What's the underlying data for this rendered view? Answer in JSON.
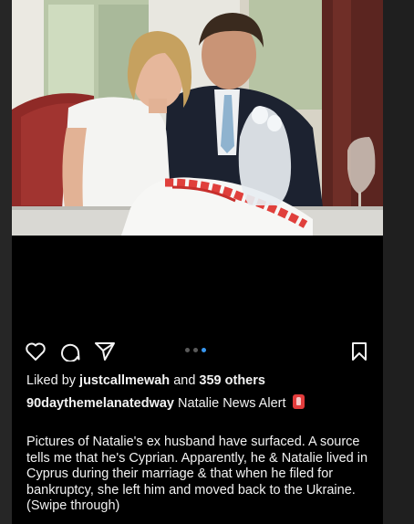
{
  "post": {
    "liked_by_prefix": "Liked by ",
    "liked_by_user": "justcallmewah",
    "liked_by_middle": " and ",
    "liked_by_count": "359 others",
    "username": "90daythemelanatedway",
    "caption_title": "Natalie News Alert",
    "caption_body": "Pictures of Natalie's ex husband have surfaced. A source tells me that he's Cyprian. Apparently, he & Natalie lived in Cyprus during their marriage & that when he filed for bankruptcy, she left him and moved back to the Ukraine. (Swipe through)",
    "carousel": {
      "total": 3,
      "active_index": 3
    }
  },
  "icons": {
    "like": "heart-icon",
    "comment": "comment-icon",
    "share": "paper-plane-icon",
    "save": "bookmark-icon",
    "alert": "alert-light-icon"
  },
  "colors": {
    "background": "#000000",
    "text": "#f2f2f2",
    "carousel_active": "#3897f0",
    "carousel_inactive": "#5a5a5a",
    "cake_decor": "#e0403c"
  }
}
